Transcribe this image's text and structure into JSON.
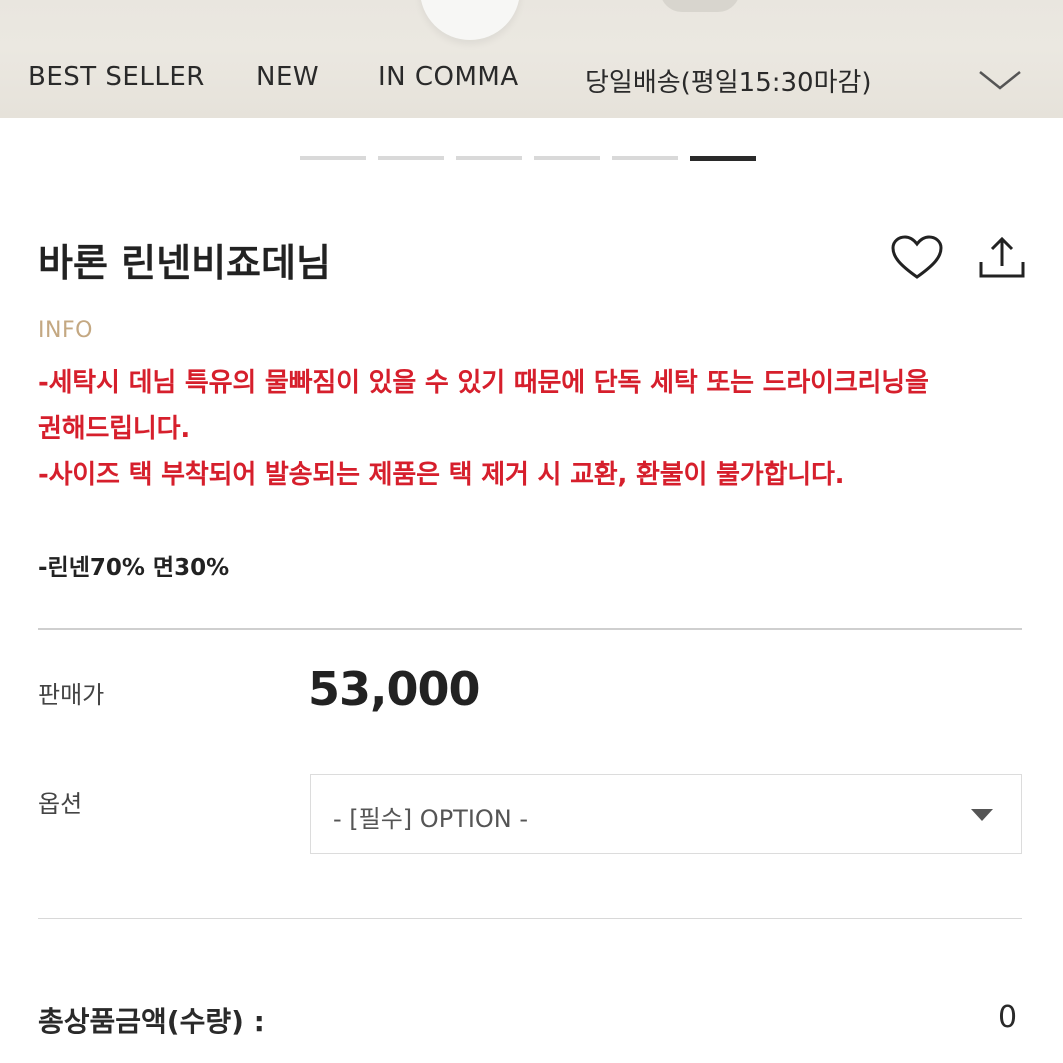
{
  "nav": {
    "items": [
      {
        "label": "BEST SELLER"
      },
      {
        "label": "NEW"
      },
      {
        "label": "IN COMMA"
      },
      {
        "label": "당일배송(평일15:30마감)"
      }
    ],
    "expand_icon": "chevron-down-icon"
  },
  "carousel": {
    "total_slides": 6,
    "active_index": 5
  },
  "product": {
    "title": "바론 린넨비죠데님",
    "info_label": "INFO",
    "notice_lines": [
      "-세탁시 데님 특유의 물빠짐이 있을 수 있기 때문에 단독 세탁 또는 드라이크리닝을",
      "권해드립니다.",
      "-사이즈 택 부착되어 발송되는 제품은 택 제거 시 교환, 환불이 불가합니다."
    ],
    "material": "-린넨70% 면30%",
    "icons": {
      "wishlist": "heart-icon",
      "share": "share-icon"
    }
  },
  "price": {
    "label": "판매가",
    "value": "53,000"
  },
  "option": {
    "label": "옵션",
    "selected": "- [필수] OPTION -"
  },
  "total": {
    "label": "총상품금액(수량) :",
    "value": "0"
  },
  "colors": {
    "notice_red": "#d61f2c",
    "info_gold": "#c4a882",
    "text_dark": "#222222"
  }
}
